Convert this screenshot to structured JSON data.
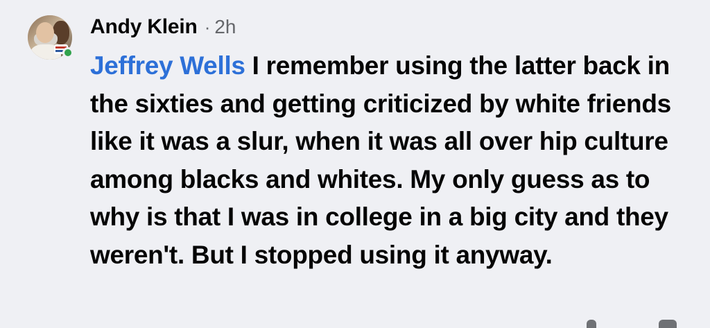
{
  "comment": {
    "author": "Andy Klein",
    "separator": "·",
    "timestamp": "2h",
    "mention": "Jeffrey Wells",
    "text": " I remember using the latter back in the sixties and getting criticized by white friends like it was a slur, when it was all over hip culture among blacks and whites. My only guess as to why is that I was in college in a big city and they weren't. But I stopped using it anyway.",
    "avatar_icon": "profile-photo",
    "online_status_icon": "online-dot-icon"
  },
  "colors": {
    "background": "#eff0f4",
    "mention": "#2d70d8",
    "online": "#31a24c",
    "secondary_text": "#65676b"
  }
}
